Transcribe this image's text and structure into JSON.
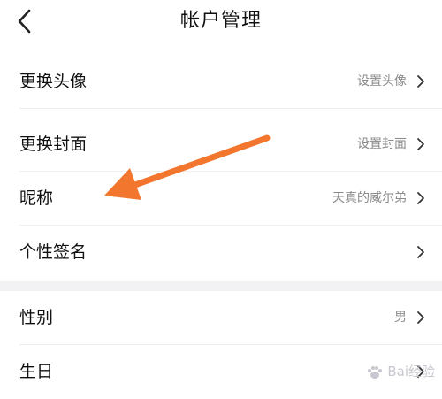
{
  "header": {
    "title": "帐户管理",
    "back_icon": "chevron-left-icon"
  },
  "rows": [
    {
      "label": "更换头像",
      "value": "设置头像"
    },
    {
      "label": "更换封面",
      "value": "设置封面"
    },
    {
      "label": "昵称",
      "value": "天真的威尔弟"
    },
    {
      "label": "个性签名",
      "value": ""
    },
    {
      "label": "性别",
      "value": "男"
    },
    {
      "label": "生日",
      "value": ""
    }
  ],
  "annotation": {
    "arrow_color": "#f2762e",
    "arrow_icon": "annotation-arrow-icon"
  },
  "watermark": {
    "text": "Bai经验",
    "icon": "paw-icon"
  },
  "colors": {
    "background": "#ffffff",
    "section_gap": "#f2f2f4",
    "secondary_text": "#8a8a8a",
    "divider": "#eeeeee"
  }
}
